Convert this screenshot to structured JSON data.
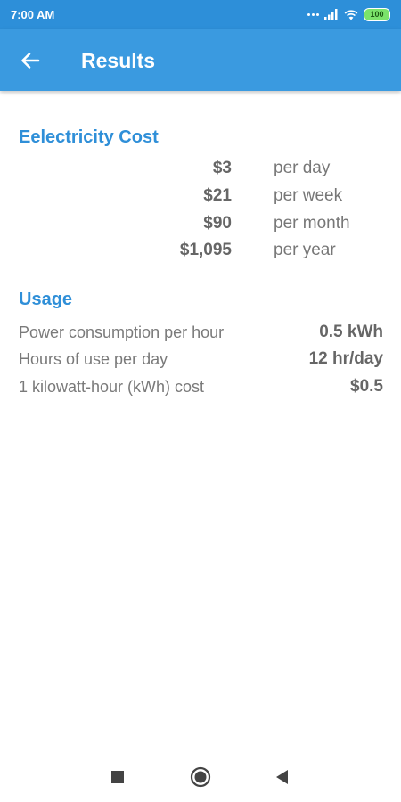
{
  "status_bar": {
    "time": "7:00 AM",
    "battery": "100"
  },
  "app_bar": {
    "title": "Results"
  },
  "electricity_cost": {
    "title": "Eelectricity Cost",
    "rows": [
      {
        "amount": "$3",
        "period": "per day"
      },
      {
        "amount": "$21",
        "period": "per week"
      },
      {
        "amount": "$90",
        "period": "per month"
      },
      {
        "amount": "$1,095",
        "period": "per year"
      }
    ]
  },
  "usage": {
    "title": "Usage",
    "rows": [
      {
        "label": "Power consumption per hour",
        "value": "0.5 kWh"
      },
      {
        "label": "Hours of use per day",
        "value": "12 hr/day"
      },
      {
        "label": "1 kilowatt-hour (kWh) cost",
        "value": "$0.5"
      }
    ]
  },
  "colors": {
    "status_bar": "#2d8fd9",
    "app_bar": "#3a9ae0",
    "section_title": "#2f8fd8",
    "battery": "#7be36b"
  },
  "icons": {
    "back": "arrow-left-icon",
    "nav_recents": "square-icon",
    "nav_home": "circle-icon",
    "nav_back": "triangle-left-icon"
  }
}
